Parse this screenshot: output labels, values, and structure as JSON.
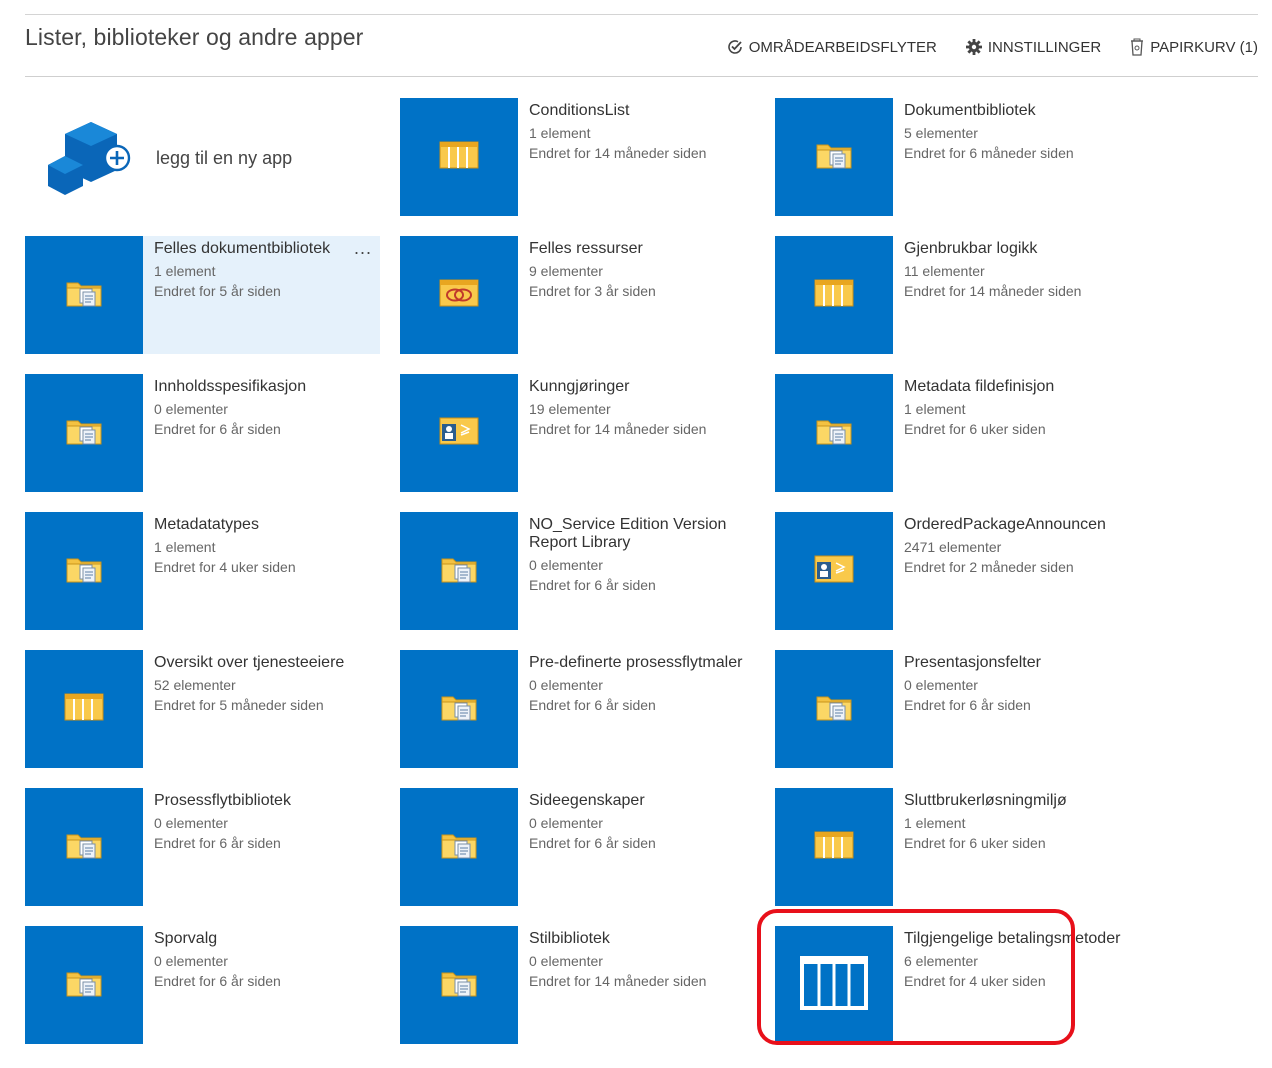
{
  "header": {
    "title": "Lister, biblioteker og andre apper",
    "actions": [
      {
        "label": "OMRÅDEARBEIDSFLYTER",
        "icon": "workflow-check-icon"
      },
      {
        "label": "INNSTILLINGER",
        "icon": "gear-icon"
      },
      {
        "label": "PAPIRKURV (1)",
        "icon": "recycle-bin-icon"
      }
    ]
  },
  "add_app": {
    "label": "legg til en ny app",
    "icon": "add-app-icon"
  },
  "tiles": [
    {
      "name": "ConditionsList",
      "count": "1 element",
      "modified": "Endret for 14 måneder siden",
      "icon": "list-icon"
    },
    {
      "name": "Dokumentbibliotek",
      "count": "5 elementer",
      "modified": "Endret for 6 måneder siden",
      "icon": "library-icon"
    },
    {
      "name": "Felles dokumentbibliotek",
      "count": "1 element",
      "modified": "Endret for 5 år siden",
      "icon": "library-icon",
      "more": "..."
    },
    {
      "name": "Felles ressurser",
      "count": "9 elementer",
      "modified": "Endret for 3 år siden",
      "icon": "resources-icon"
    },
    {
      "name": "Gjenbrukbar logikk",
      "count": "11 elementer",
      "modified": "Endret for 14 måneder siden",
      "icon": "list-icon"
    },
    {
      "name": "Innholdsspesifikasjon",
      "count": "0 elementer",
      "modified": "Endret for 6 år siden",
      "icon": "library-icon"
    },
    {
      "name": "Kunngjøringer",
      "count": "19 elementer",
      "modified": "Endret for 14 måneder siden",
      "icon": "announcement-icon"
    },
    {
      "name": "Metadata fildefinisjon",
      "count": "1 element",
      "modified": "Endret for 6 uker siden",
      "icon": "library-icon"
    },
    {
      "name": "Metadatatypes",
      "count": "1 element",
      "modified": "Endret for 4 uker siden",
      "icon": "library-icon"
    },
    {
      "name": "NO_Service Edition Version Report Library",
      "count": "0 elementer",
      "modified": "Endret for 6 år siden",
      "icon": "library-icon"
    },
    {
      "name": "OrderedPackageAnnouncen",
      "count": "2471 elementer",
      "modified": "Endret for 2 måneder siden",
      "icon": "announcement-icon"
    },
    {
      "name": "Oversikt over tjenesteeiere",
      "count": "52 elementer",
      "modified": "Endret for 5 måneder siden",
      "icon": "list-icon"
    },
    {
      "name": "Pre-definerte prosessflytmaler",
      "count": "0 elementer",
      "modified": "Endret for 6 år siden",
      "icon": "library-icon"
    },
    {
      "name": "Presentasjonsfelter",
      "count": "0 elementer",
      "modified": "Endret for 6 år siden",
      "icon": "library-icon"
    },
    {
      "name": "Prosessflytbibliotek",
      "count": "0 elementer",
      "modified": "Endret for 6 år siden",
      "icon": "library-icon"
    },
    {
      "name": "Sideegenskaper",
      "count": "0 elementer",
      "modified": "Endret for 6 år siden",
      "icon": "library-icon"
    },
    {
      "name": "Sluttbrukerløsningmiljø",
      "count": "1 element",
      "modified": "Endret for 6 uker siden",
      "icon": "list-icon"
    },
    {
      "name": "Sporvalg",
      "count": "0 elementer",
      "modified": "Endret for 6 år siden",
      "icon": "library-icon"
    },
    {
      "name": "Stilbibliotek",
      "count": "0 elementer",
      "modified": "Endret for 14 måneder siden",
      "icon": "library-icon"
    },
    {
      "name": "Tilgjengelige betalingsmetoder",
      "count": "6 elementer",
      "modified": "Endret for 4 uker siden",
      "icon": "large-list-icon"
    }
  ],
  "colors": {
    "tile": "#0072c6",
    "highlight_ring": "#e8101a",
    "hover": "#e5f1fb"
  }
}
